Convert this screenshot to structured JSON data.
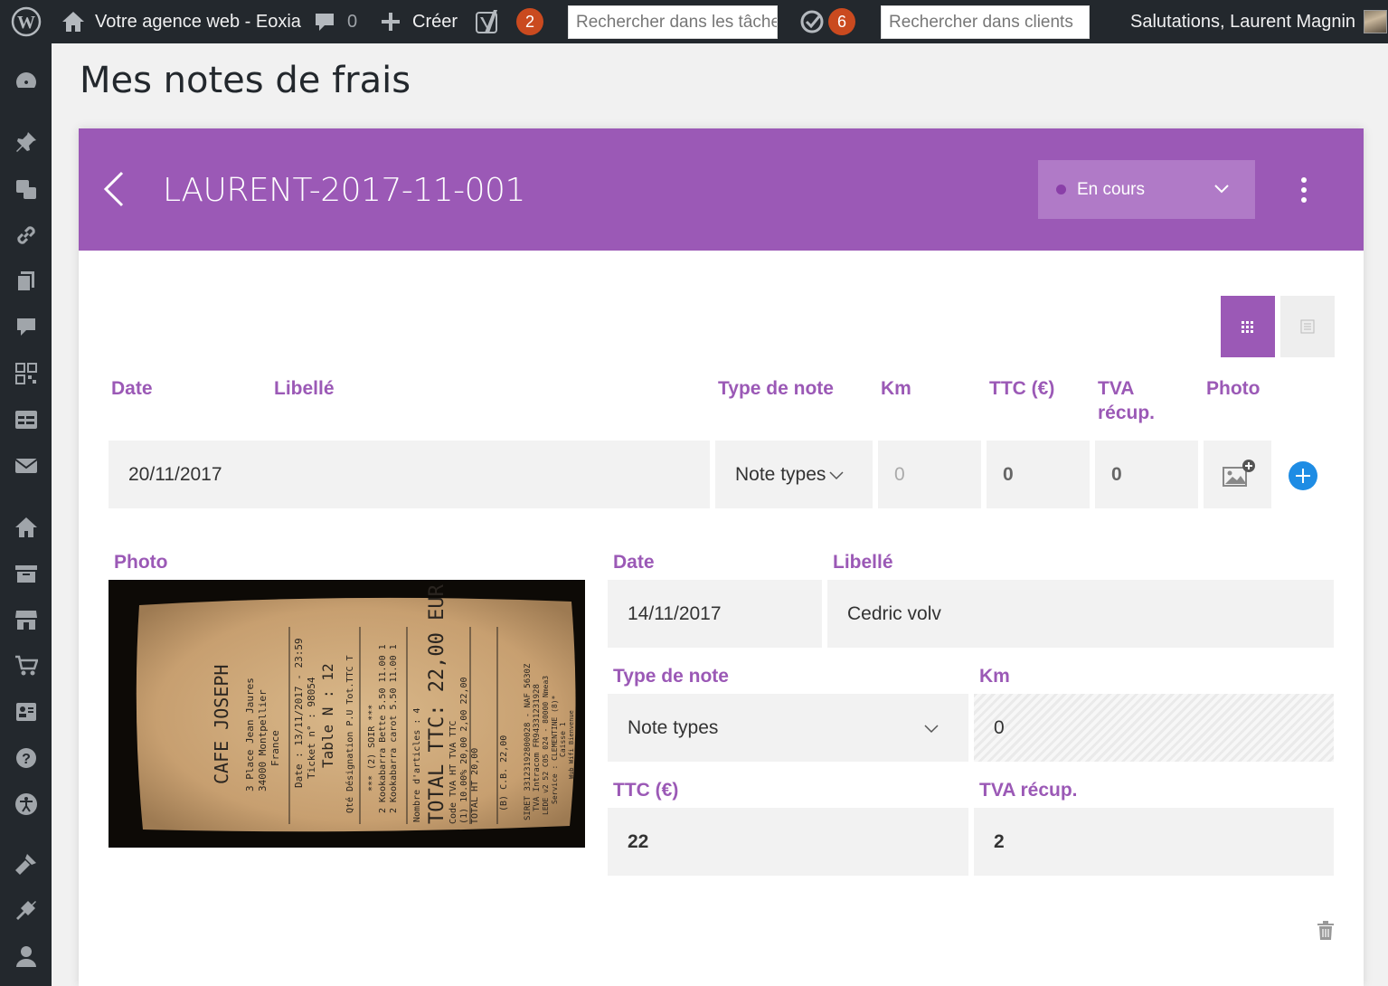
{
  "adminbar": {
    "site_name": "Votre agence web - Eoxia",
    "comments_count": "0",
    "new_label": "Créer",
    "seo_badge": "2",
    "tasks_search_placeholder": "Rechercher dans les tâche",
    "tasks_badge": "6",
    "clients_search_placeholder": "Rechercher dans clients",
    "greeting": "Salutations, Laurent Magnin"
  },
  "page": {
    "title": "Mes notes de frais"
  },
  "note": {
    "reference": "LAURENT-2017-11-001",
    "status": "En cours"
  },
  "table": {
    "headers": {
      "date": "Date",
      "label": "Libellé",
      "type": "Type de note",
      "km": "Km",
      "ttc": "TTC (€)",
      "tva_line1": "TVA",
      "tva_line2": "récup.",
      "photo": "Photo"
    },
    "new_row": {
      "date": "20/11/2017",
      "type": "Note types",
      "km_placeholder": "0",
      "ttc": "0",
      "tva": "0"
    }
  },
  "detail": {
    "photo_label": "Photo",
    "date_label": "Date",
    "date_value": "14/11/2017",
    "label_label": "Libellé",
    "label_value": "Cedric volv",
    "type_label": "Type de note",
    "type_value": "Note types",
    "km_label": "Km",
    "km_value": "0",
    "ttc_label": "TTC (€)",
    "ttc_value": "22",
    "tva_label": "TVA récup.",
    "tva_value": "2"
  },
  "receipt": {
    "shop": "CAFE JOSEPH",
    "address1": "3 Place Jean Jaures",
    "address2": "34000 Montpellier",
    "country": "France",
    "date_line": "Date : 13/11/2017 - 23:59",
    "ticket_line": "Ticket n° : 98054",
    "table_line": "Table N : 12",
    "cols_line": "Qté Désignation        P.U Tot.TTC T",
    "soir_line": "*** (2) SOIR ***",
    "item1": "2 Kookabarra Bette    5.50  11.00 1",
    "item2": "2 Kookabarra carot    5.50  11.00 1",
    "nb_articles": "Nombre d'articles : 4",
    "total": "TOTAL TTC:  22,00 EUR",
    "tva_head": "Code TVA       HT    TVA    TTC",
    "tva_row": "(1) 10.00%  20,00   2,00  22,00",
    "total_ht": "TOTAL HT    20,00",
    "cb_line": "(B) C.B.                    22,00",
    "siret": "SIRET 33123192800028 - NAF 5630Z",
    "tva_intra": "TVA Intracom FR94331231928",
    "lede": "LEDE v2 52 C05 024 - 80000 Nmea3",
    "service": "Service : CLEMENTINE (8)*",
    "caisse": "Caisse 1",
    "wifi": "Wub Wifi Bienvenue"
  },
  "colors": {
    "accent": "#9b59b6",
    "adminbar": "#23282d",
    "add": "#1e8ce4"
  }
}
